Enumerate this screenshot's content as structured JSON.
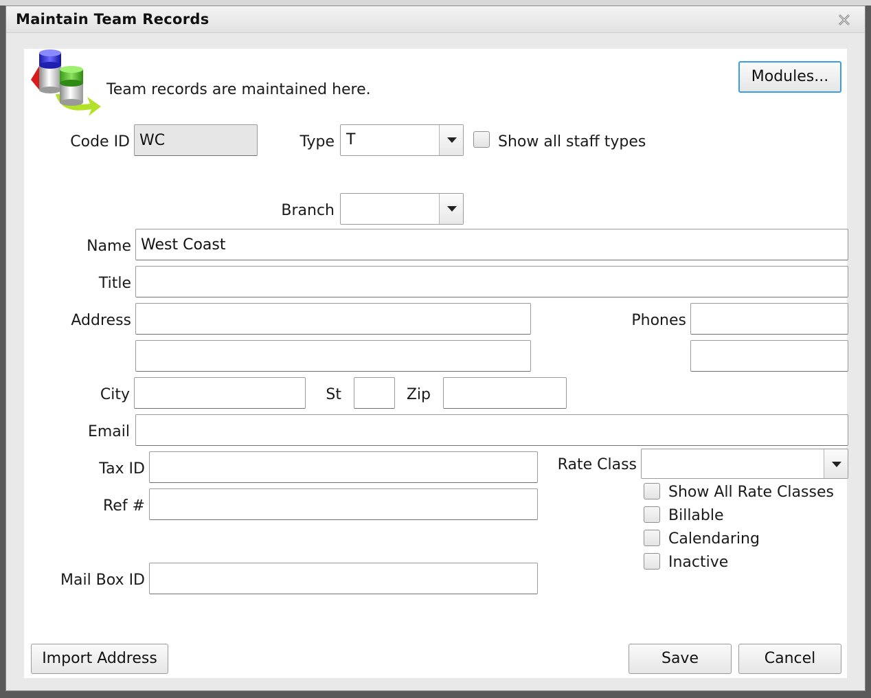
{
  "window": {
    "title": "Maintain Team Records"
  },
  "header": {
    "message": "Team records are maintained here.",
    "modules_label": "Modules..."
  },
  "form": {
    "code_id": {
      "label": "Code ID",
      "value": "WC"
    },
    "type": {
      "label": "Type",
      "value": "T"
    },
    "show_all_staff_types": {
      "label": "Show all staff types",
      "checked": false
    },
    "branch": {
      "label": "Branch",
      "value": ""
    },
    "name": {
      "label": "Name",
      "value": "West Coast"
    },
    "title": {
      "label": "Title",
      "value": ""
    },
    "address": {
      "label": "Address",
      "line1": "",
      "line2": ""
    },
    "phones": {
      "label": "Phones",
      "phone1": "",
      "phone2": ""
    },
    "city": {
      "label": "City",
      "value": ""
    },
    "state": {
      "label": "St",
      "value": ""
    },
    "zip": {
      "label": "Zip",
      "value": ""
    },
    "email": {
      "label": "Email",
      "value": ""
    },
    "tax_id": {
      "label": "Tax ID",
      "value": ""
    },
    "ref": {
      "label": "Ref #",
      "value": ""
    },
    "mailbox_id": {
      "label": "Mail Box ID",
      "value": ""
    },
    "rate_class": {
      "label": "Rate Class",
      "value": ""
    },
    "checkboxes": [
      {
        "label": "Show All Rate Classes",
        "checked": false
      },
      {
        "label": "Billable",
        "checked": false
      },
      {
        "label": "Calendaring",
        "checked": false
      },
      {
        "label": "Inactive",
        "checked": false
      }
    ]
  },
  "footer": {
    "import_label": "Import Address",
    "save_label": "Save",
    "cancel_label": "Cancel"
  }
}
